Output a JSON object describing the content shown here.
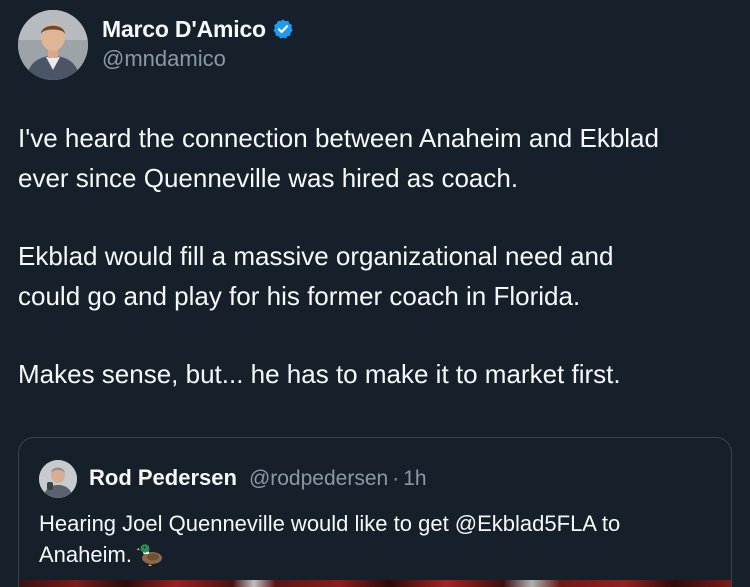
{
  "tweet": {
    "author": {
      "name": "Marco D'Amico",
      "handle": "@mndamico",
      "verified_icon": "verified-badge-icon",
      "verified_color": "#1d9bf0"
    },
    "body": {
      "paragraph1_line1": "I've heard the connection between Anaheim and Ekblad",
      "paragraph1_line2": "ever since Quenneville was hired as coach.",
      "paragraph2_line1": "Ekblad would fill a massive organizational need and",
      "paragraph2_line2": "could go and play for his former coach in Florida.",
      "paragraph3_line1": "Makes sense, but... he has to make it to market first."
    },
    "quote": {
      "name": "Rod Pedersen",
      "handle": "@rodpedersen",
      "separator": "·",
      "time": "1h",
      "text_line1": "Hearing Joel Quenneville would like to get @Ekblad5FLA to",
      "text_line2": "Anaheim.",
      "emoji_icon": "duck-icon"
    }
  },
  "colors": {
    "background": "#15202b",
    "text_primary": "#f7f9f9",
    "text_secondary": "#8b98a5",
    "border": "#38444d",
    "accent": "#1d9bf0"
  }
}
